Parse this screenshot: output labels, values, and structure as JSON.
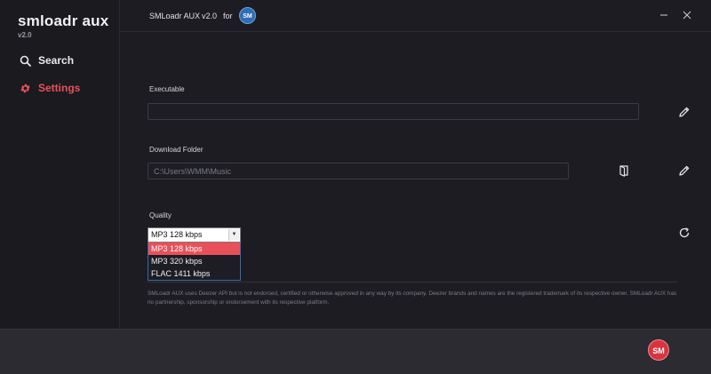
{
  "sidebar": {
    "brand_title": "smloadr aux",
    "brand_version": "v2.0",
    "items": [
      {
        "label": "Search",
        "icon": "search-icon",
        "active": false
      },
      {
        "label": "Settings",
        "icon": "gear-icon",
        "active": true
      }
    ]
  },
  "titlebar": {
    "app_name": "SMLoadr AUX",
    "version": "v2.0",
    "for_text": "for",
    "logo_text": "SM"
  },
  "settings": {
    "executable_label": "Executable",
    "executable_value": "",
    "download_folder_label": "Download Folder",
    "download_folder_value": "C:\\Users\\WMM\\Music",
    "quality_label": "Quality",
    "quality_selected": "MP3 128 kbps",
    "quality_options": [
      "MP3 128 kbps",
      "MP3 320 kbps",
      "FLAC 1411 kbps"
    ]
  },
  "disclaimer": "SMLoadr AUX uses Deezer API but is not endorsed, certified or otherwise approved in any way by its company. Deezer brands and names are the registered trademark of its respective owner. SMLoadr AUX has no partnership, sponsorship or endorsement with its respective platform.",
  "footer": {
    "logo_text": "SM"
  },
  "colors": {
    "accent": "#e8515a",
    "background": "#1c1c22",
    "sidebar": "#1a1a1f",
    "footer": "#2b2b31",
    "logo_blue": "#2f6db5"
  }
}
